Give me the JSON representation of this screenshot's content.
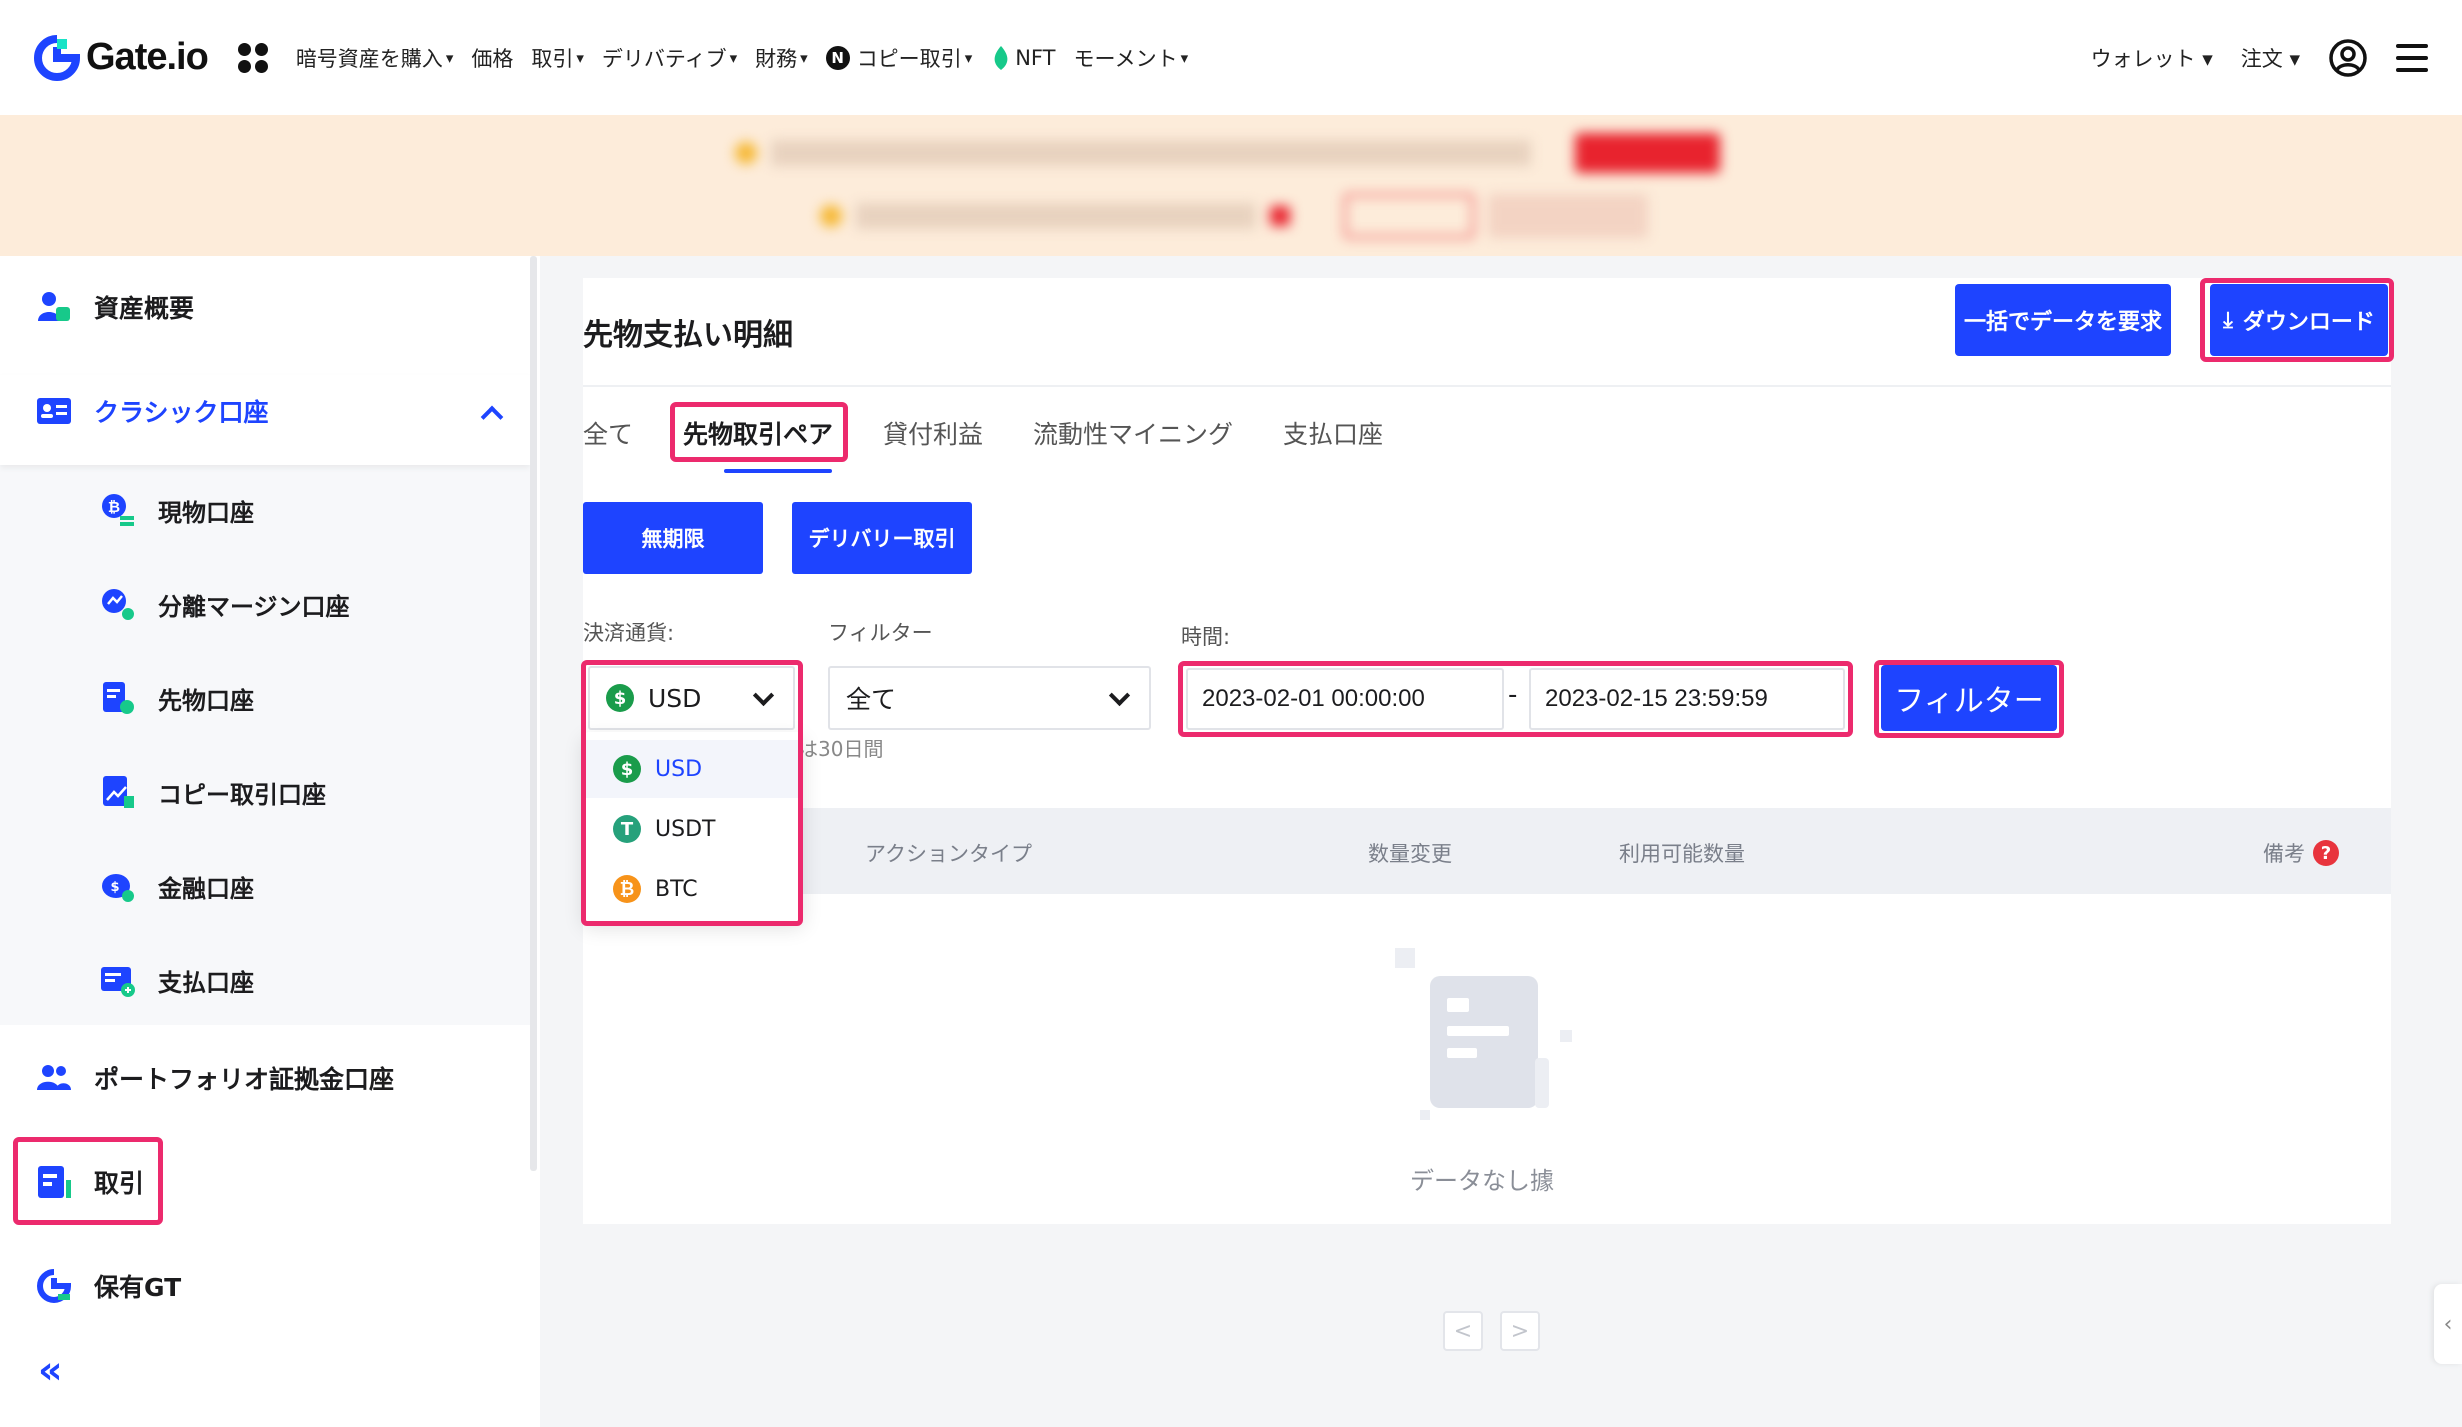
{
  "nav": {
    "logo_text": "Gate.io",
    "items": [
      {
        "label": "暗号資産を購入",
        "caret": "▾"
      },
      {
        "label": "価格",
        "caret": ""
      },
      {
        "label": "取引",
        "caret": "▾"
      },
      {
        "label": "デリバティブ",
        "caret": "▾"
      },
      {
        "label": "財務",
        "caret": "▾"
      },
      {
        "label": "コピー取引",
        "caret": "▾",
        "badge": "N"
      },
      {
        "label": "NFT",
        "caret": ""
      },
      {
        "label": "モーメント",
        "caret": "▾"
      }
    ],
    "wallet": "ウォレット ▾",
    "orders": "注文 ▾"
  },
  "sidebar": {
    "asset_overview": "資産概要",
    "classic": "クラシック口座",
    "sub": [
      "現物口座",
      "分離マージン口座",
      "先物口座",
      "コピー取引口座",
      "金融口座",
      "支払口座"
    ],
    "portfolio": "ポートフォリオ証拠金口座",
    "trade": "取引",
    "gt": "保有GT",
    "collapse": "«"
  },
  "main": {
    "title": "先物支払い明細",
    "bulk_button": "一括でデータを要求",
    "download_icon": "⤓",
    "download_button": "ダウンロード",
    "tabs": [
      "全て",
      "先物取引ペア",
      "貸付利益",
      "流動性マイニング",
      "支払口座"
    ],
    "subtabs": [
      "無期限",
      "デリバリー取引"
    ],
    "currency_label": "決済通貨:",
    "currency_value": "USD",
    "filter_label": "フィルター",
    "filter_value": "全て",
    "time_label": "時間:",
    "date_from": "2023-02-01 00:00:00",
    "date_to": "2023-02-15 23:59:59",
    "date_sep": "-",
    "filter_button": "フィルター",
    "note": "は30日間",
    "dropdown": [
      {
        "coin": "$",
        "label": "USD"
      },
      {
        "coin": "T",
        "label": "USDT"
      },
      {
        "coin": "₿",
        "label": "BTC"
      }
    ],
    "columns": [
      "アクションタイプ",
      "数量変更",
      "利用可能数量",
      "備考"
    ],
    "remark_icon": "?",
    "empty": "データなし據",
    "pager_prev": "<",
    "pager_next": ">"
  },
  "colors": {
    "accent": "#1e44ff",
    "highlight": "#ec2a6d",
    "banner_bg": "#fdecda"
  }
}
